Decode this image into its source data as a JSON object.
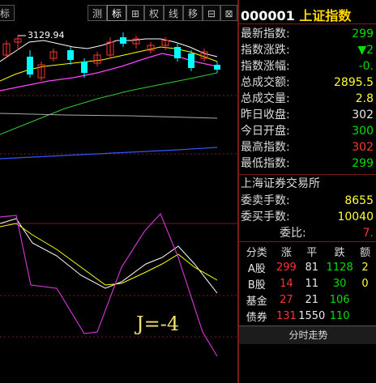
{
  "toolbar": {
    "items": [
      "标",
      "测",
      "标",
      "⊞",
      "权",
      "线",
      "移",
      "⊟",
      "⊠"
    ]
  },
  "chart": {
    "peak_label": "3129.94",
    "indicator_label": "J=-4",
    "colors": {
      "up": "#ff3333",
      "down": "#00ffff",
      "ma_white": "#ffffff",
      "ma_yellow": "#ffff00",
      "ma_magenta": "#ff44ff",
      "ma_green": "#33cc33",
      "ma_blue": "#3355ff"
    }
  },
  "quote": {
    "code": "000001",
    "name": "上证指数",
    "rows": [
      {
        "label": "最新指数:",
        "value": "299",
        "color": "green"
      },
      {
        "label": "指数涨跌:",
        "value": "▼2",
        "color": "green"
      },
      {
        "label": "指数涨幅:",
        "value": "-0.",
        "color": "green"
      },
      {
        "label": "总成交额:",
        "value": "2895.5",
        "color": "yellow"
      },
      {
        "label": "总成交量:",
        "value": "2.8",
        "color": "yellow"
      },
      {
        "label": "昨日收盘:",
        "value": "302",
        "color": "white"
      },
      {
        "label": "今日开盘:",
        "value": "300",
        "color": "green"
      },
      {
        "label": "最高指数:",
        "value": "302",
        "color": "red"
      },
      {
        "label": "最低指数:",
        "value": "299",
        "color": "green"
      }
    ],
    "exchange": "上海证券交易所",
    "rows2": [
      {
        "label": "委卖手数:",
        "value": "8655",
        "color": "yellow"
      },
      {
        "label": "委买手数:",
        "value": "10040",
        "color": "yellow"
      },
      {
        "label": "委比:",
        "value": "7.",
        "color": "red"
      }
    ],
    "stats": {
      "headers": [
        "分类",
        "涨",
        "平",
        "跌",
        "额"
      ],
      "rows": [
        {
          "name": "A股",
          "up": "299",
          "flat": "81",
          "down": "1128",
          "amt": "2"
        },
        {
          "name": "B股",
          "up": "14",
          "flat": "11",
          "down": "30",
          "amt": "0"
        },
        {
          "name": "基金",
          "up": "27",
          "flat": "21",
          "down": "106",
          "amt": ""
        },
        {
          "name": "债券",
          "up": "131",
          "flat": "1550",
          "down": "110",
          "amt": ""
        }
      ]
    },
    "bottom_button": "分时走势"
  }
}
